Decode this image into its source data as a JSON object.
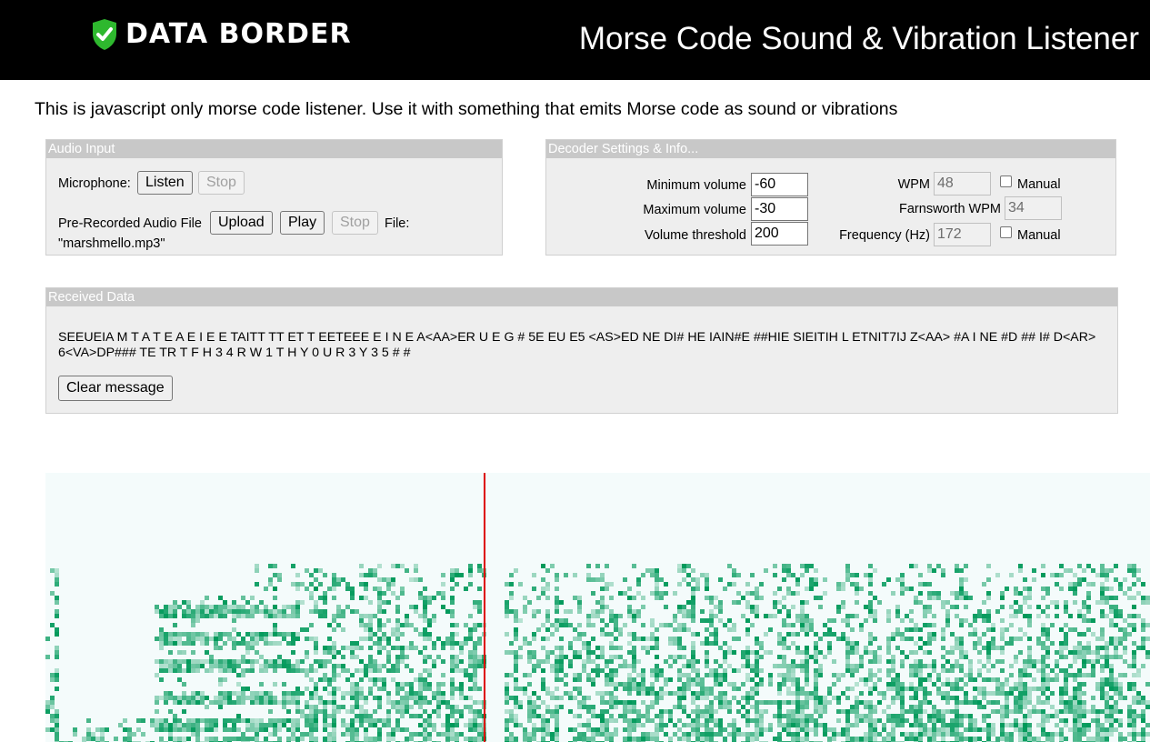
{
  "header": {
    "logo_text": "DATA BORDER",
    "title": "Morse Code Sound & Vibration Listener"
  },
  "intro": "This is javascript only morse code listener. Use it with something that emits Morse code as sound or vibrations",
  "audio_input": {
    "heading": "Audio Input",
    "microphone_label": "Microphone:",
    "listen_label": "Listen",
    "stop_label": "Stop",
    "file_label": "Pre-Recorded Audio File",
    "upload_label": "Upload",
    "play_label": "Play",
    "file_stop_label": "Stop",
    "file_prefix": "File:",
    "file_name": "\"marshmello.mp3\""
  },
  "decoder": {
    "heading": "Decoder Settings & Info...",
    "min_volume_label": "Minimum volume",
    "min_volume": "-60",
    "max_volume_label": "Maximum volume",
    "max_volume": "-30",
    "threshold_label": "Volume threshold",
    "threshold": "200",
    "wpm_label": "WPM",
    "wpm": "48",
    "wpm_manual_label": "Manual",
    "farnsworth_label": "Farnsworth WPM",
    "farnsworth": "34",
    "frequency_label": "Frequency (Hz)",
    "frequency": "172",
    "freq_manual_label": "Manual"
  },
  "received": {
    "heading": "Received Data",
    "message": "SEEUEIA M T A T E A E I E E TAITT TT ET T EETEEE E I N E A<AA>ER U E G # 5E EU E5 <AS>ED NE DI# HE IAIN#E ##HIE SIEITIH L ETNIT7IJ Z<AA> #A I NE #D ## I# D<AR> 6<VA>DP### TE TR T F H 3 4 R W 1 T H Y 0 U R 3 Y 3 5 # #",
    "clear_label": "Clear message"
  },
  "colors": {
    "header_bg": "#000000",
    "logo_green": "#2eb82e",
    "spectrogram_green": "#00995a",
    "playhead": "#dd0000"
  }
}
